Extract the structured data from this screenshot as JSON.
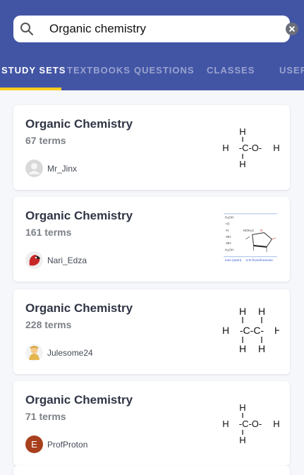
{
  "search": {
    "query": "Organic chemistry",
    "search_icon": "search-icon",
    "clear_icon": "close-circle-icon"
  },
  "tabs": [
    {
      "label": "STUDY SETS",
      "active": true
    },
    {
      "label": "TEXTBOOKS",
      "active": false
    },
    {
      "label": "QUESTIONS",
      "active": false
    },
    {
      "label": "CLASSES",
      "active": false
    },
    {
      "label": "USERS",
      "active": false
    }
  ],
  "results": [
    {
      "title": "Organic Chemistry",
      "terms": "67 terms",
      "user": "Mr_Jinx",
      "avatar": "default-person-avatar",
      "thumbnail": "methanol-structure",
      "structure": {
        "top": "H",
        "middle": "-C-O-",
        "bottom": "H",
        "left": "H",
        "right": "H"
      }
    },
    {
      "title": "Organic Chemistry",
      "terms": "161 terms",
      "user": "Nari_Edza",
      "avatar": "parrot-avatar",
      "thumbnail": "fructofuranose-diagram",
      "diagram_labels": {
        "chain": [
          "H₂OH",
          "=O",
          "-H",
          "-OH",
          "-OH",
          "H₂OH"
        ],
        "ring_top": "HOH₂C",
        "ring_side": "O",
        "left_caption": "tose (open)",
        "right_caption": "α-D-fructofuranose"
      }
    },
    {
      "title": "Organic Chemistry",
      "terms": "228 terms",
      "user": "Julesome24",
      "avatar": "cartoon-character-avatar",
      "thumbnail": "ethane-structure",
      "structure": {
        "top": [
          "H",
          "H"
        ],
        "middle": "-C-C-",
        "bottom": [
          "H",
          "H"
        ],
        "left": "H",
        "right": "H"
      }
    },
    {
      "title": "Organic Chemistry",
      "terms": "71 terms",
      "user": "ProfProton",
      "avatar": "letter-avatar",
      "avatar_letter": "E",
      "thumbnail": "methanol-structure",
      "structure": {
        "top": "H",
        "middle": "-C-O-",
        "bottom": "H",
        "left": "H",
        "right": "H"
      }
    }
  ],
  "colors": {
    "header": "#4255a5",
    "tab_active": "#ffffff",
    "tab_inactive": "#9aa3cf",
    "tab_underline": "#ffcd1f",
    "background": "#f6f7fb",
    "avatar_letter_bg": "#a8401d"
  }
}
